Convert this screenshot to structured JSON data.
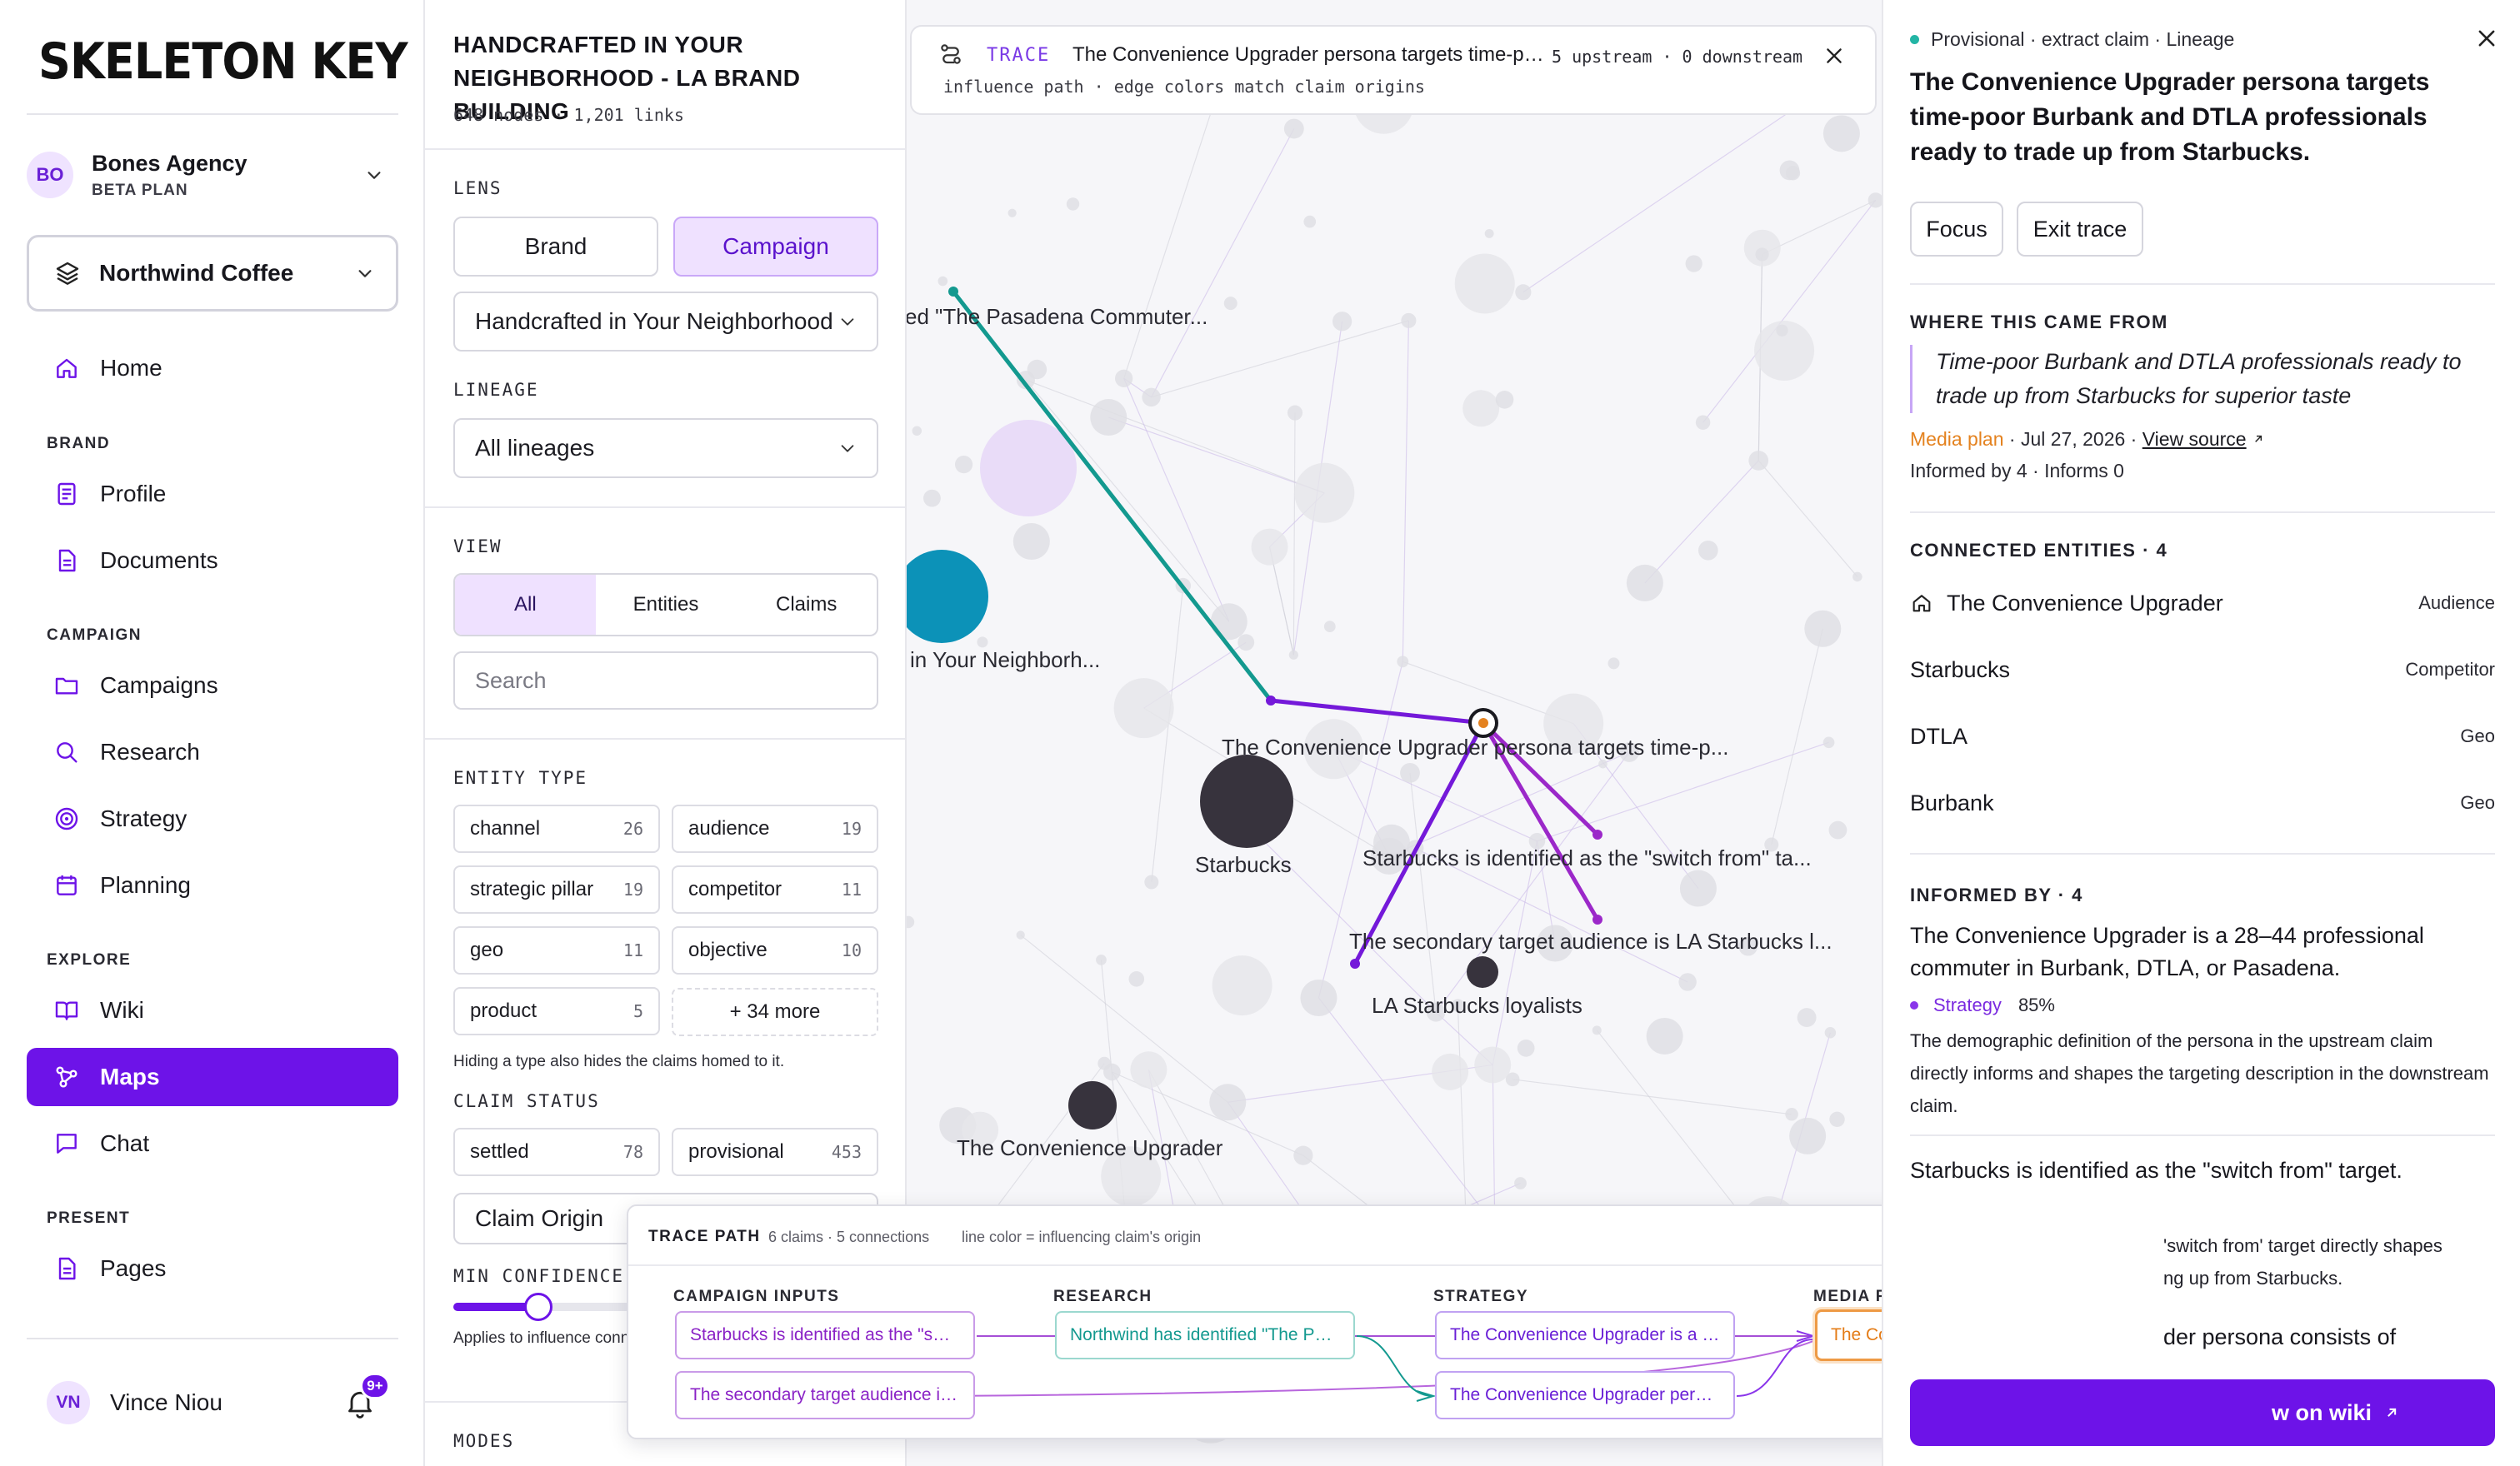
{
  "sidebar": {
    "logo": "SKELETON KEY",
    "org": {
      "initials": "BO",
      "name": "Bones Agency",
      "plan": "BETA PLAN"
    },
    "brand": "Northwind Coffee",
    "home": "Home",
    "sections": {
      "brand": "BRAND",
      "campaign": "CAMPAIGN",
      "explore": "EXPLORE",
      "present": "PRESENT"
    },
    "items": {
      "profile": "Profile",
      "documents": "Documents",
      "campaigns": "Campaigns",
      "research": "Research",
      "strategy": "Strategy",
      "planning": "Planning",
      "wiki": "Wiki",
      "maps": "Maps",
      "chat": "Chat",
      "pages": "Pages"
    },
    "user": {
      "initials": "VN",
      "name": "Vince Niou",
      "notifications": "9+"
    }
  },
  "controls": {
    "title": "HANDCRAFTED IN YOUR NEIGHBORHOOD - LA BRAND BUILDING",
    "stats": "648 nodes · 1,201 links",
    "lens": {
      "label": "LENS",
      "brand": "Brand",
      "campaign": "Campaign",
      "selected": "Handcrafted in Your Neighborhood - LA Brand Building"
    },
    "lineage": {
      "label": "LINEAGE",
      "selected": "All lineages"
    },
    "view": {
      "label": "VIEW",
      "all": "All",
      "entities": "Entities",
      "claims": "Claims"
    },
    "search": {
      "placeholder": "Search"
    },
    "entity_type": {
      "label": "ENTITY TYPE",
      "chips": [
        {
          "name": "channel",
          "count": "26"
        },
        {
          "name": "audience",
          "count": "19"
        },
        {
          "name": "strategic pillar",
          "count": "19"
        },
        {
          "name": "competitor",
          "count": "11"
        },
        {
          "name": "geo",
          "count": "11"
        },
        {
          "name": "objective",
          "count": "10"
        },
        {
          "name": "product",
          "count": "5"
        }
      ],
      "more": "+ 34 more",
      "hint": "Hiding a type also hides the claims homed to it."
    },
    "claim_status": {
      "label": "CLAIM STATUS",
      "chips": [
        {
          "name": "settled",
          "count": "78"
        },
        {
          "name": "provisional",
          "count": "453"
        }
      ]
    },
    "claim_origin": "Claim Origin",
    "min_confidence": {
      "label": "MIN CONFIDENCE",
      "value": 0.2,
      "note": "Applies to influence connections in."
    },
    "modes": "MODES"
  },
  "graph": {
    "colors": {
      "teal": "#13998f",
      "purple": "#7419d9",
      "magenta": "#9b28c9",
      "dark": "#37333d",
      "cyan": "#0c92b8",
      "lavender": "#e4d3f7"
    },
    "labels": {
      "pasadena": "ed \"The Pasadena Commuter...",
      "neighborhood": "in Your Neighborh...",
      "persona": "The Convenience Upgrader persona targets time-p...",
      "starbucks": "Starbucks",
      "switch": "Starbucks is identified as the \"switch from\" ta...",
      "secondary": "The secondary target audience is LA Starbucks l...",
      "loyalists": "LA Starbucks loyalists",
      "upgrader": "The Convenience Upgrader"
    }
  },
  "trace": {
    "tag": "TRACE",
    "title": "The Convenience Upgrader persona targets time-poor Burbank and DTLA professionals ready to trade up from Starbucks.",
    "counts": "5 upstream · 0 downstream",
    "subtitle": "influence path · edge colors match claim origins"
  },
  "trace_path": {
    "title": "TRACE PATH",
    "meta": "6 claims · 5 connections",
    "legend": "line color = influencing claim's origin",
    "columns": {
      "inputs": "CAMPAIGN INPUTS",
      "research": "RESEARCH",
      "strategy": "STRATEGY",
      "media": "MEDIA PLAN"
    },
    "nodes": {
      "input1": "Starbucks is identified as the \"switch from\" target.",
      "input2": "The secondary target audience is LA Starbucks loyalists.",
      "research1": "Northwind has identified \"The Pasadena Commuter\"",
      "strategy1": "The Convenience Upgrader is a 28–44 professional",
      "strategy2": "The Convenience Upgrader persona consists of",
      "media1": "The Convenience Upgrader persona targets time-poor"
    }
  },
  "detail": {
    "crumb": "Provisional · extract claim · Lineage",
    "title": "The Convenience Upgrader persona targets time-poor Burbank and DTLA professionals ready to trade up from Starbucks.",
    "focus": "Focus",
    "exit_trace": "Exit trace",
    "origin": {
      "heading": "WHERE THIS CAME FROM",
      "quote": "Time-poor Burbank and DTLA professionals ready to trade up from Starbucks for superior taste",
      "source": "Media plan",
      "date": "· Jul 27, 2026 ·",
      "view_source": "View source",
      "informed": "Informed by 4 · Informs 0"
    },
    "entities": {
      "heading": "CONNECTED ENTITIES · 4",
      "rows": [
        {
          "name": "The Convenience Upgrader",
          "type": "Audience"
        },
        {
          "name": "Starbucks",
          "type": "Competitor"
        },
        {
          "name": "DTLA",
          "type": "Geo"
        },
        {
          "name": "Burbank",
          "type": "Geo"
        }
      ]
    },
    "informed_by": {
      "heading": "INFORMED BY · 4",
      "items": [
        {
          "text": "The Convenience Upgrader is a 28–44 professional commuter in Burbank, DTLA, or Pasadena.",
          "origin": "Strategy",
          "confidence": "85%",
          "desc": "The demographic definition of the persona in the upstream claim directly informs and shapes the targeting description in the downstream claim."
        },
        {
          "text": "Starbucks is identified as the \"switch from\" target.",
          "desc_partial": "'switch from' target directly shapes",
          "desc_partial2": "ng up from Starbucks."
        },
        {
          "text_partial": "der persona consists of"
        }
      ]
    },
    "wiki_button": "w on wiki"
  }
}
